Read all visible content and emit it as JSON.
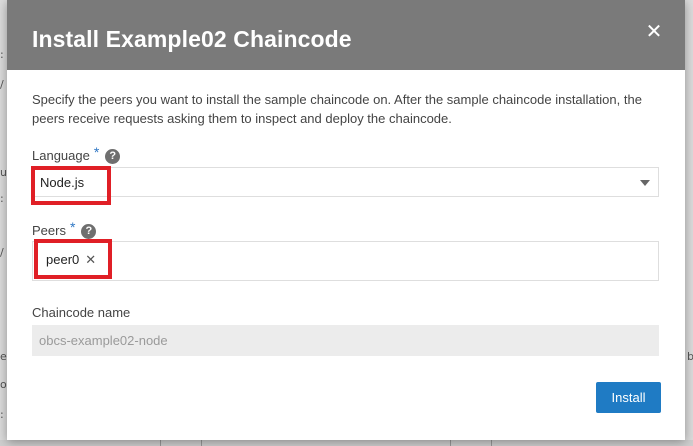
{
  "dialog": {
    "title": "Install Example02 Chaincode",
    "close_icon": "close-icon",
    "description": "Specify the peers you want to install the sample chaincode on. After the sample chaincode installation, the peers receive requests asking them to inspect and deploy the chaincode.",
    "language": {
      "label": "Language",
      "required_mark": "*",
      "help_glyph": "?",
      "selected": "Node.js"
    },
    "peers": {
      "label": "Peers",
      "required_mark": "*",
      "help_glyph": "?",
      "chips": [
        {
          "label": "peer0",
          "remove_glyph": "✕"
        }
      ]
    },
    "chaincode_name": {
      "label": "Chaincode name",
      "value": "obcs-example02-node"
    },
    "install_label": "Install"
  },
  "colors": {
    "header_bg": "#7a7a7a",
    "accent": "#1f7bc4",
    "required": "#2f77c4",
    "highlight": "#e01f26"
  }
}
